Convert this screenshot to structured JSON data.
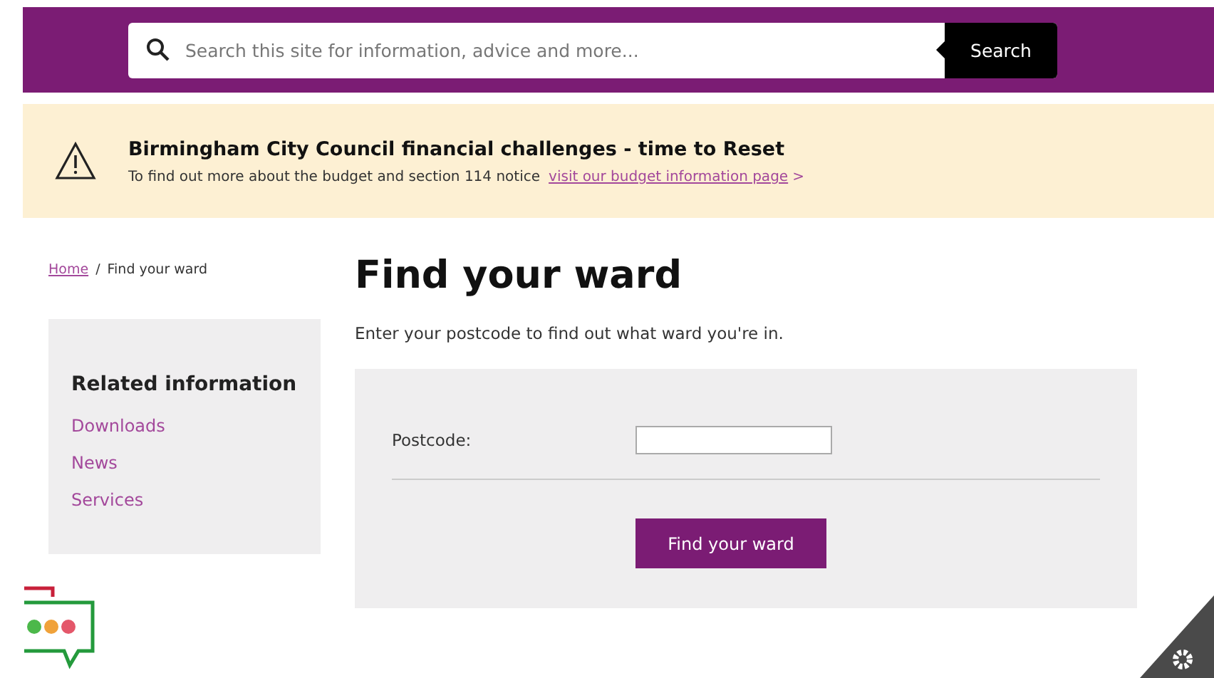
{
  "search": {
    "placeholder": "Search this site for information, advice and more...",
    "button": "Search"
  },
  "alert": {
    "title": "Birmingham City Council financial challenges - time to Reset",
    "text": "To find out more about the budget and section 114 notice",
    "link": "visit our budget information page",
    "link_suffix": ">"
  },
  "breadcrumb": {
    "home": "Home",
    "separator": "/",
    "current": "Find your ward"
  },
  "sidebar": {
    "title": "Related information",
    "items": [
      "Downloads",
      "News",
      "Services"
    ]
  },
  "main": {
    "heading": "Find your ward",
    "intro": "Enter your postcode to find out what ward you're in.",
    "form": {
      "label": "Postcode:",
      "button": "Find your ward"
    }
  }
}
